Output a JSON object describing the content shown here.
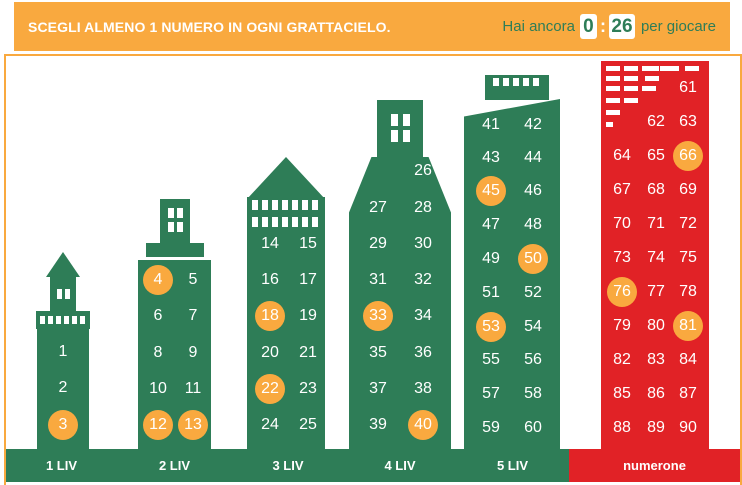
{
  "header": {
    "instructions": "SCEGLI ALMENO 1 NUMERO IN OGNI GRATTACIELO.",
    "timer_prefix": "Hai ancora",
    "timer_minutes": "0",
    "timer_colon": ":",
    "timer_seconds": "26",
    "timer_suffix": "per giocare"
  },
  "colors": {
    "building_green": "#2e7d57",
    "numerone_red": "#e12226",
    "accent_orange": "#f9a93f"
  },
  "levels": [
    {
      "label": "1 LIV",
      "numbers": [
        "1",
        "2",
        "3"
      ],
      "selected": [
        "3"
      ]
    },
    {
      "label": "2 LIV",
      "numbers": [
        "4",
        "5",
        "6",
        "7",
        "8",
        "9",
        "10",
        "11",
        "12",
        "13"
      ],
      "selected": [
        "4",
        "12",
        "13"
      ]
    },
    {
      "label": "3 LIV",
      "numbers": [
        "14",
        "15",
        "16",
        "17",
        "18",
        "19",
        "20",
        "21",
        "22",
        "23",
        "24",
        "25"
      ],
      "selected": [
        "18",
        "22"
      ]
    },
    {
      "label": "4 LIV",
      "numbers": [
        "26",
        "27",
        "28",
        "29",
        "30",
        "31",
        "32",
        "33",
        "34",
        "35",
        "36",
        "37",
        "38",
        "39",
        "40"
      ],
      "selected": [
        "33",
        "40"
      ]
    },
    {
      "label": "5 LIV",
      "numbers": [
        "41",
        "42",
        "43",
        "44",
        "45",
        "46",
        "47",
        "48",
        "49",
        "50",
        "51",
        "52",
        "53",
        "54",
        "55",
        "56",
        "57",
        "58",
        "59",
        "60"
      ],
      "selected": [
        "45",
        "50",
        "53"
      ]
    },
    {
      "label": "numerone",
      "numbers": [
        "61",
        "62",
        "63",
        "64",
        "65",
        "66",
        "67",
        "68",
        "69",
        "70",
        "71",
        "72",
        "73",
        "74",
        "75",
        "76",
        "77",
        "78",
        "79",
        "80",
        "81",
        "82",
        "83",
        "84",
        "85",
        "86",
        "87",
        "88",
        "89",
        "90"
      ],
      "selected": [
        "66",
        "76",
        "81"
      ]
    }
  ]
}
